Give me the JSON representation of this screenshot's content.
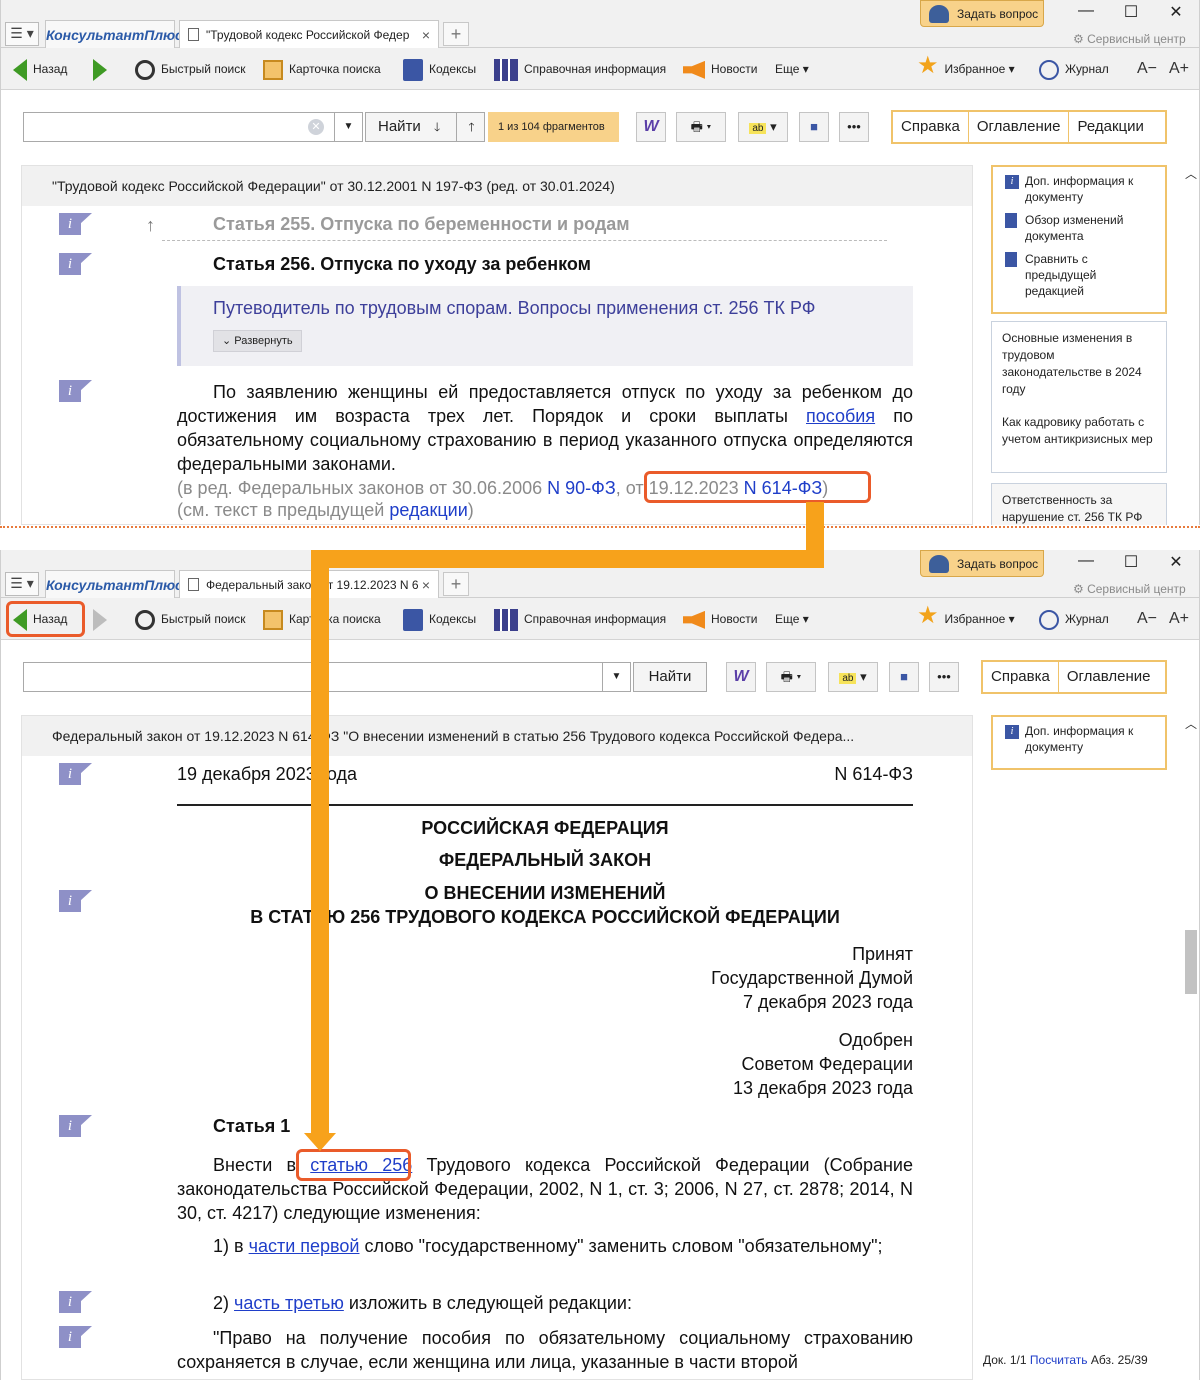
{
  "app": {
    "brand": "КонсультантПлюс",
    "ask_question": "Задать вопрос",
    "service_center": "Сервисный центр",
    "toolbar": {
      "back": "Назад",
      "quick_search": "Быстрый поиск",
      "search_card": "Карточка поиска",
      "codes": "Кодексы",
      "reference": "Справочная информация",
      "news": "Новости",
      "more": "Еще",
      "favorites": "Избранное",
      "journal": "Журнал",
      "font_dec": "A−",
      "font_inc": "A+"
    },
    "find_label": "Найти"
  },
  "top": {
    "tab_title": "\"Трудовой кодекс Российской Федер",
    "fragments": "1 из 104 фрагментов",
    "right_tabs": [
      "Справка",
      "Оглавление",
      "Редакции"
    ],
    "doc_header": "\"Трудовой кодекс Российской Федерации\" от 30.12.2001 N 197-ФЗ (ред. от 30.01.2024)",
    "prev_article": "Статья 255. Отпуска по беременности и родам",
    "article": "Статья 256. Отпуска по уходу за ребенком",
    "guide": "Путеводитель по трудовым спорам. Вопросы применения ст. 256 ТК РФ",
    "expand": "Развернуть",
    "para_text": "По заявлению женщины ей предоставляется отпуск по уходу за ребенком до достижения им возраста трех лет. Порядок и сроки выплаты",
    "para_link": "пособия",
    "para_tail": "по обязательному социальному страхованию в период указанного отпуска определяются федеральными законами.",
    "edit_prefix": "(в ред. Федеральных законов от 30.06.2006",
    "edit_link1": "N 90-ФЗ",
    "edit_mid": ", от 19.12.2023",
    "edit_link2": "N 614-ФЗ",
    "edit_end": ")",
    "see_prefix": "(см. текст в предыдущей",
    "see_link": "редакции",
    "see_end": ")",
    "sidebar_links": [
      "Доп. информация к документу",
      "Обзор изменений документа",
      "Сравнить с предыдущей редакцией"
    ],
    "sidebar_info": [
      "Основные изменения в трудовом законодательстве в 2024 году",
      "Как кадровику работать с учетом антикризисных мер"
    ],
    "sidebar_info2": "Ответственность за нарушение ст. 256 ТК РФ"
  },
  "bottom": {
    "tab_title": "Федеральный закон от 19.12.2023 N 6",
    "right_tabs": [
      "Справка",
      "Оглавление"
    ],
    "doc_header": "Федеральный закон от 19.12.2023 N 614-ФЗ \"О внесении изменений в статью 256 Трудового кодекса Российской Федера...",
    "date_line": "19 декабря 2023 года",
    "number": "N 614-ФЗ",
    "country": "РОССИЙСКАЯ ФЕДЕРАЦИЯ",
    "law_type": "ФЕДЕРАЛЬНЫЙ ЗАКОН",
    "law_title1": "О ВНЕСЕНИИ ИЗМЕНЕНИЙ",
    "law_title2": "В СТАТЬЮ 256 ТРУДОВОГО КОДЕКСА РОССИЙСКОЙ ФЕДЕРАЦИИ",
    "accepted": [
      "Принят",
      "Государственной Думой",
      "7 декабря 2023 года"
    ],
    "approved": [
      "Одобрен",
      "Советом Федерации",
      "13 декабря 2023 года"
    ],
    "article1": "Статья 1",
    "p1_pre": "Внести в",
    "p1_link": "статью 256",
    "p1_tail": "Трудового кодекса Российской Федерации (Собрание законодательства Российской Федерации, 2002, N 1, ст. 3; 2006, N 27, ст. 2878; 2014, N 30, ст. 4217) следующие изменения:",
    "i1_pre": "1) в",
    "i1_link": "части первой",
    "i1_tail": "слово \"государственному\" заменить словом \"обязательному\";",
    "i2_pre": "2)",
    "i2_link": "часть третью",
    "i2_tail": "изложить в следующей редакции:",
    "quote": "\"Право на получение пособия по обязательному социальному страхованию сохраняется в случае, если женщина или лица, указанные в части второй",
    "sidebar_links": [
      "Доп. информация к документу"
    ],
    "status_doc": "Док. 1/1",
    "status_count": "Посчитать",
    "status_par": "Абз. 25/39"
  },
  "colors": {
    "highlight": "#ea5b2a",
    "arrow": "#f7a21b",
    "link": "#1f3ec9"
  }
}
